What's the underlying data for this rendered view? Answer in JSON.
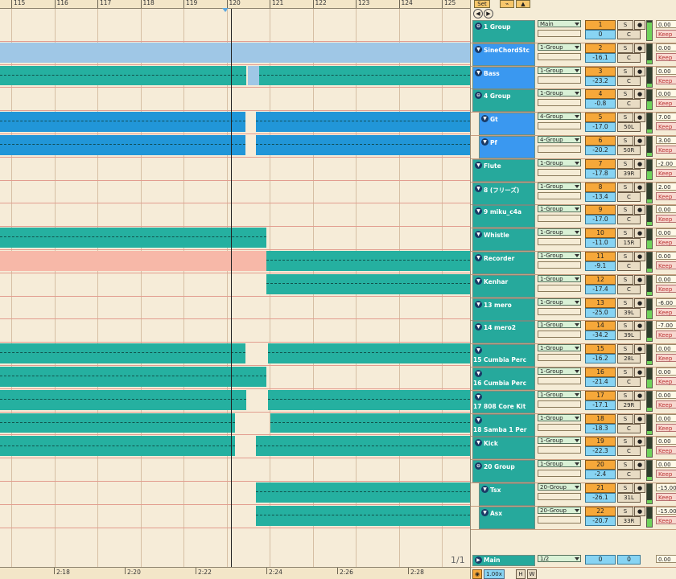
{
  "ruler": {
    "bars": [
      "115",
      "116",
      "117",
      "118",
      "119",
      "120",
      "121",
      "122",
      "123",
      "124",
      "125"
    ]
  },
  "timeline": {
    "labels": [
      "2:18",
      "2:20",
      "2:22",
      "2:24",
      "2:26",
      "2:28"
    ]
  },
  "page_indicator": "1/1",
  "mixer_header": {
    "set_label": "Set",
    "btn1": "⌁",
    "btn2": "▲"
  },
  "mixer_footer": {
    "zoom": "1.00x",
    "h_label": "H",
    "w_label": "W"
  },
  "colors": {
    "teal": "#25b0a0",
    "lightblue": "#9fc7e6",
    "blue": "#2196d8",
    "salmon": "#f7b8a8",
    "name_blue": "#3a98f0",
    "name_teal": "#26a99c"
  },
  "tracks": [
    {
      "name": "1 Group",
      "route": "Main",
      "num": "1",
      "vol": "0",
      "pan": "C",
      "out": "0.00",
      "keep": "Keep",
      "folded": false,
      "group": true,
      "nameColor": "teal"
    },
    {
      "name": "SineChordStc",
      "route": "1-Group",
      "num": "2",
      "vol": "-16.1",
      "pan": "C",
      "out": "0.00",
      "keep": "Keep",
      "nameColor": "blue"
    },
    {
      "name": "Bass",
      "route": "1-Group",
      "num": "3",
      "vol": "-23.2",
      "pan": "C",
      "out": "0.00",
      "keep": "Keep",
      "nameColor": "blue"
    },
    {
      "name": "4 Group",
      "route": "1-Group",
      "num": "4",
      "vol": "-0.8",
      "pan": "C",
      "out": "0.00",
      "keep": "Keep",
      "group": true,
      "nameColor": "teal"
    },
    {
      "name": "Gt",
      "route": "4-Group",
      "num": "5",
      "vol": "-17.0",
      "pan": "50L",
      "out": "7.00",
      "keep": "Keep",
      "nameColor": "blue"
    },
    {
      "name": "Pf",
      "route": "4-Group",
      "num": "6",
      "vol": "-20.2",
      "pan": "50R",
      "out": "3.00",
      "keep": "Keep",
      "nameColor": "blue"
    },
    {
      "name": "Flute",
      "route": "1-Group",
      "num": "7",
      "vol": "-17.8",
      "pan": "39R",
      "out": "-2.00",
      "keep": "Keep",
      "nameColor": "teal"
    },
    {
      "name": "8 (フリーズ)",
      "route": "1-Group",
      "num": "8",
      "vol": "-13.4",
      "pan": "C",
      "out": "2.00",
      "keep": "Keep",
      "nameColor": "teal"
    },
    {
      "name": "9 miku_c4a",
      "route": "1-Group",
      "num": "9",
      "vol": "-17.0",
      "pan": "C",
      "out": "0.00",
      "keep": "Keep",
      "nameColor": "teal"
    },
    {
      "name": "Whistle",
      "route": "1-Group",
      "num": "10",
      "vol": "-11.0",
      "pan": "15R",
      "out": "0.00",
      "keep": "Keep",
      "nameColor": "teal"
    },
    {
      "name": "Recorder",
      "route": "1-Group",
      "num": "11",
      "vol": "-9.1",
      "pan": "C",
      "out": "0.00",
      "keep": "Keep",
      "nameColor": "teal"
    },
    {
      "name": "Kenhar",
      "route": "1-Group",
      "num": "12",
      "vol": "-17.4",
      "pan": "C",
      "out": "0.00",
      "keep": "Keep",
      "nameColor": "teal"
    },
    {
      "name": "13 mero",
      "route": "1-Group",
      "num": "13",
      "vol": "-25.0",
      "pan": "39L",
      "out": "-6.00",
      "keep": "Keep",
      "nameColor": "teal"
    },
    {
      "name": "14 mero2",
      "route": "1-Group",
      "num": "14",
      "vol": "-34.2",
      "pan": "39L",
      "out": "-7.00",
      "keep": "Keep",
      "nameColor": "teal"
    },
    {
      "name": "15 Cumbia Perc",
      "route": "1-Group",
      "num": "15",
      "vol": "-16.2",
      "pan": "28L",
      "out": "0.00",
      "keep": "Keep",
      "nameColor": "teal"
    },
    {
      "name": "16 Cumbia Perc",
      "route": "1-Group",
      "num": "16",
      "vol": "-21.4",
      "pan": "C",
      "out": "0.00",
      "keep": "Keep",
      "nameColor": "teal"
    },
    {
      "name": "17 808 Core Kit",
      "route": "1-Group",
      "num": "17",
      "vol": "-17.1",
      "pan": "29R",
      "out": "0.00",
      "keep": "Keep",
      "nameColor": "teal"
    },
    {
      "name": "18 Samba 1 Per",
      "route": "1-Group",
      "num": "18",
      "vol": "-18.3",
      "pan": "C",
      "out": "0.00",
      "keep": "Keep",
      "nameColor": "teal"
    },
    {
      "name": "Kick",
      "route": "1-Group",
      "num": "19",
      "vol": "-22.3",
      "pan": "C",
      "out": "0.00",
      "keep": "Keep",
      "nameColor": "teal"
    },
    {
      "name": "20 Group",
      "route": "1-Group",
      "num": "20",
      "vol": "-2.4",
      "pan": "C",
      "out": "0.00",
      "keep": "Keep",
      "group": true,
      "nameColor": "teal"
    },
    {
      "name": "Tsx",
      "route": "20-Group",
      "num": "21",
      "vol": "-26.1",
      "pan": "31L",
      "out": "-15.00",
      "keep": "Keep",
      "nameColor": "teal"
    },
    {
      "name": "Asx",
      "route": "20-Group",
      "num": "22",
      "vol": "-20.7",
      "pan": "33R",
      "out": "-15.00",
      "keep": "Keep",
      "nameColor": "teal"
    }
  ],
  "main": {
    "name": "Main",
    "route": "1/2",
    "vol": "0",
    "pan": "0",
    "out": "0.00"
  }
}
